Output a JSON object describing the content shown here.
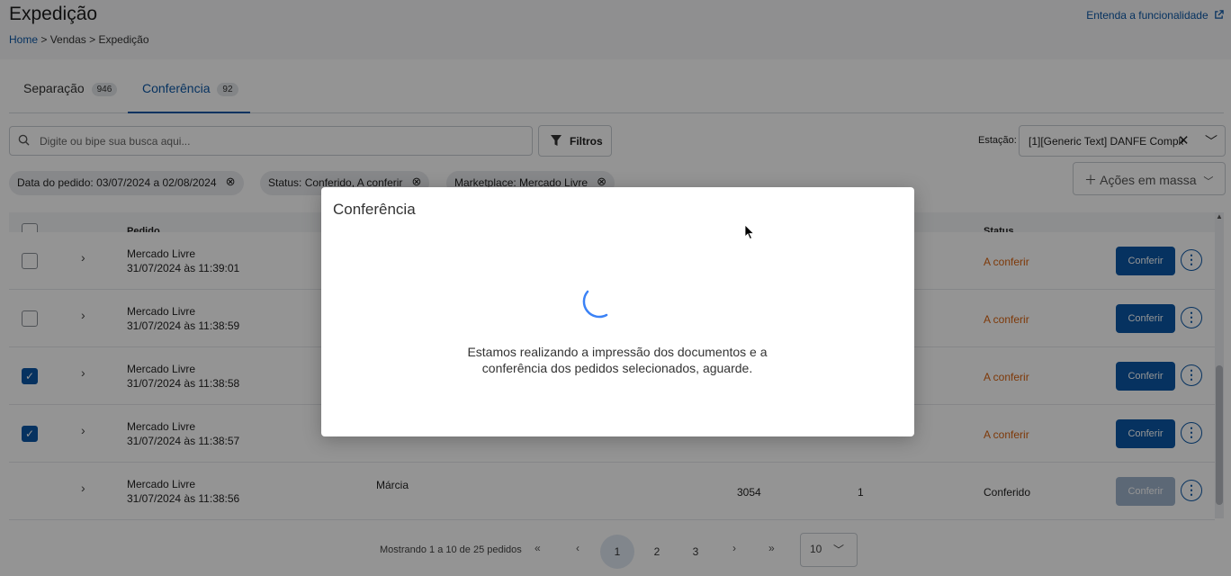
{
  "header": {
    "title": "Expedição",
    "breadcrumb": {
      "home": "Home",
      "sep1": ">",
      "vendas": "Vendas",
      "sep2": ">",
      "current": "Expedição"
    },
    "help_link": "Entenda a funcionalidade",
    "help_icon": "external-link-icon"
  },
  "tabs": [
    {
      "label": "Separação",
      "count": "946",
      "active": false
    },
    {
      "label": "Conferência",
      "count": "92",
      "active": true
    }
  ],
  "search": {
    "placeholder": "Digite ou bipe sua busca aqui...",
    "icon": "search-icon"
  },
  "filters_button": {
    "label": "Filtros",
    "icon": "filter-icon"
  },
  "station": {
    "label": "Estação:",
    "value": "[1][Generic Text] DANFE Comple..."
  },
  "chips": [
    {
      "label": "Data do pedido: 03/07/2024 a 02/08/2024"
    },
    {
      "label": "Status: Conferido, A conferir"
    },
    {
      "label": "Marketplace: Mercado Livre"
    }
  ],
  "mass_actions": {
    "label": "Ações em massa"
  },
  "table": {
    "headers": {
      "order": "Pedido",
      "status": "Status"
    },
    "rows": [
      {
        "marketplace": "Mercado Livre",
        "date": "31/07/2024 às 11:39:01",
        "customer": "",
        "number": "",
        "qty": "",
        "status": "A conferir",
        "checked": false,
        "action": "Conferir",
        "action_enabled": true
      },
      {
        "marketplace": "Mercado Livre",
        "date": "31/07/2024 às 11:38:59",
        "customer": "",
        "number": "",
        "qty": "",
        "status": "A conferir",
        "checked": false,
        "action": "Conferir",
        "action_enabled": true
      },
      {
        "marketplace": "Mercado Livre",
        "date": "31/07/2024 às 11:38:58",
        "customer": "",
        "number": "",
        "qty": "",
        "status": "A conferir",
        "checked": true,
        "action": "Conferir",
        "action_enabled": true
      },
      {
        "marketplace": "Mercado Livre",
        "date": "31/07/2024 às 11:38:57",
        "customer": "",
        "number": "",
        "qty": "",
        "status": "A conferir",
        "checked": true,
        "action": "Conferir",
        "action_enabled": true
      },
      {
        "marketplace": "Mercado Livre",
        "date": "31/07/2024 às 11:38:56",
        "customer": "Márcia",
        "number": "3054",
        "qty": "1",
        "status": "Conferido",
        "checked": false,
        "action": "Conferir",
        "action_enabled": false
      }
    ]
  },
  "pagination": {
    "info": "Mostrando 1 a 10 de 25 pedidos",
    "first": "«",
    "prev": "‹",
    "pages": [
      "1",
      "2",
      "3"
    ],
    "current_page": "1",
    "next": "›",
    "last": "»",
    "page_size": "10"
  },
  "modal": {
    "title": "Conferência",
    "message": "Estamos realizando a impressão dos documentos e a conferência dos pedidos selecionados, aguarde."
  },
  "colors": {
    "primary": "#0b57a6",
    "pending": "#d9620f",
    "spinner": "#3b82f6"
  }
}
